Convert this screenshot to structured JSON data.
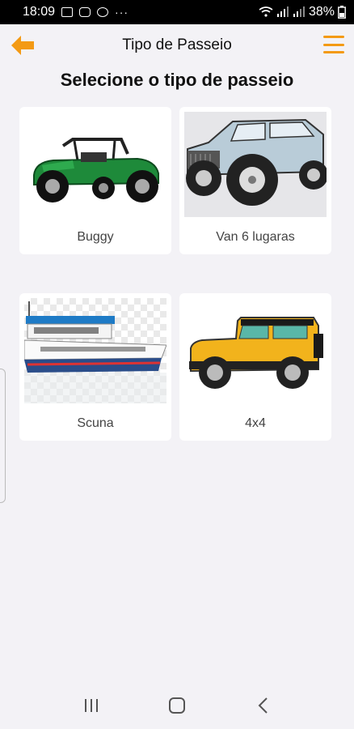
{
  "status_bar": {
    "time": "18:09",
    "more": "···",
    "battery": "38%"
  },
  "header": {
    "title": "Tipo de Passeio",
    "back_icon": "arrow-left-icon",
    "menu_icon": "hamburger-menu-icon"
  },
  "subtitle": "Selecione o tipo de passeio",
  "options": [
    {
      "label": "Buggy",
      "image": "buggy-image"
    },
    {
      "label": "Van 6 lugaras",
      "image": "jeep-offroad-image"
    },
    {
      "label": "Scuna",
      "image": "schooner-boat-image"
    },
    {
      "label": "4x4",
      "image": "yellow-4x4-image"
    }
  ],
  "colors": {
    "accent": "#f39a14",
    "background": "#f3f2f6",
    "card": "#ffffff"
  },
  "nav": {
    "recents_icon": "recents-icon",
    "home_icon": "home-icon",
    "back_icon": "back-chevron-icon"
  }
}
